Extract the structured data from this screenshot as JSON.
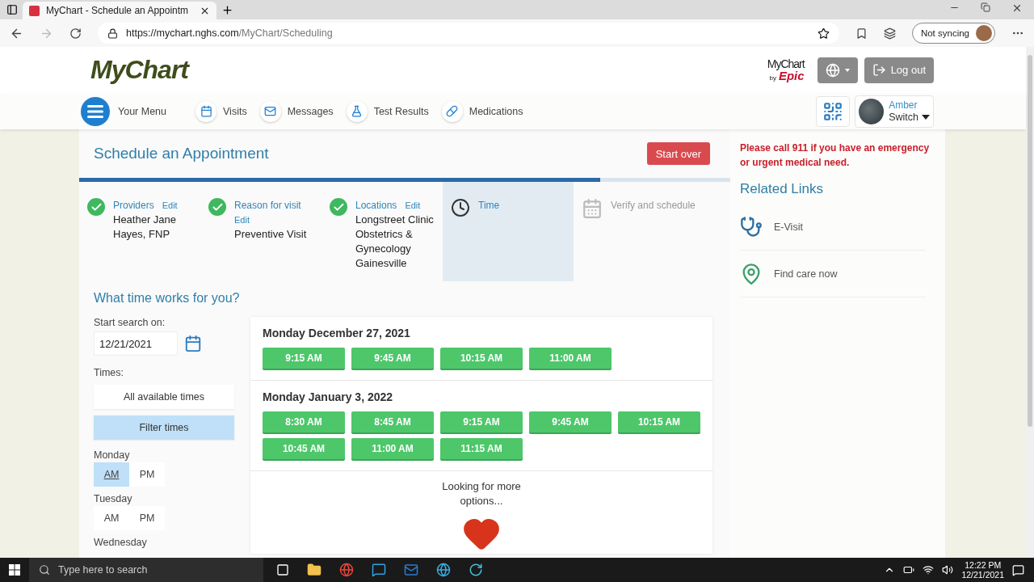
{
  "browser": {
    "tab_title": "MyChart - Schedule an Appointm",
    "url_host": "https://mychart.nghs.com",
    "url_path": "/MyChart/Scheduling",
    "sync_label": "Not syncing"
  },
  "header": {
    "logo": "MyChart",
    "epic_logo_top": "MyChart",
    "epic_logo_by": "by",
    "epic_logo_brand": "Epic",
    "logout": "Log out"
  },
  "nav": {
    "menu_label": "Your Menu",
    "items": [
      {
        "label": "Visits",
        "kind": "calendar"
      },
      {
        "label": "Messages",
        "kind": "mail"
      },
      {
        "label": "Test Results",
        "kind": "flask"
      },
      {
        "label": "Medications",
        "kind": "pill"
      }
    ],
    "user_name": "Amber",
    "switch_label": "Switch"
  },
  "page": {
    "title": "Schedule an Appointment",
    "start_over": "Start over",
    "progress": {
      "level": 0.8
    },
    "steps": [
      {
        "label": "Providers",
        "edit": "Edit",
        "detail": "Heather Jane Hayes, FNP",
        "kind": "done",
        "selected": false
      },
      {
        "label": "Reason for visit",
        "edit": "Edit",
        "detail": "Preventive Visit",
        "kind": "done",
        "selected": false
      },
      {
        "label": "Locations",
        "edit": "Edit",
        "detail": "Longstreet Clinic Obstetrics & Gynecology Gainesville",
        "kind": "done",
        "selected": false
      },
      {
        "label": "Time",
        "kind": "current",
        "selected": true
      },
      {
        "label": "Verify and schedule",
        "kind": "pending",
        "selected": false
      }
    ],
    "question": "What time works for you?",
    "filters": {
      "start_label": "Start search on:",
      "date": "12/21/2021",
      "times_label": "Times:",
      "time_options": [
        {
          "label": "All available times",
          "selected": false
        },
        {
          "label": "Filter times",
          "selected": true
        }
      ],
      "days": [
        {
          "name": "Monday",
          "options": [
            {
              "label": "AM",
              "selected": true
            },
            {
              "label": "PM",
              "selected": false
            }
          ]
        },
        {
          "name": "Tuesday",
          "options": [
            {
              "label": "AM",
              "selected": false
            },
            {
              "label": "PM",
              "selected": false
            }
          ]
        },
        {
          "name": "Wednesday"
        }
      ]
    },
    "slots": [
      {
        "date": "Monday December 27, 2021",
        "times": [
          "9:15 AM",
          "9:45 AM",
          "10:15 AM",
          "11:00 AM"
        ]
      },
      {
        "date": "Monday January 3, 2022",
        "times": [
          "8:30 AM",
          "8:45 AM",
          "9:15 AM",
          "9:45 AM",
          "10:15 AM",
          "10:45 AM",
          "11:00 AM",
          "11:15 AM"
        ]
      }
    ],
    "more": "Looking for more options..."
  },
  "sidebar": {
    "emergency": "Please call 911 if you have an emergency or urgent medical need.",
    "related_title": "Related Links",
    "links": [
      {
        "label": "E-Visit",
        "kind": "stethoscope"
      },
      {
        "label": "Find care now",
        "kind": "map"
      }
    ]
  },
  "taskbar": {
    "search_placeholder": "Type here to search",
    "time": "12:22 PM",
    "date": "12/21/2021"
  }
}
